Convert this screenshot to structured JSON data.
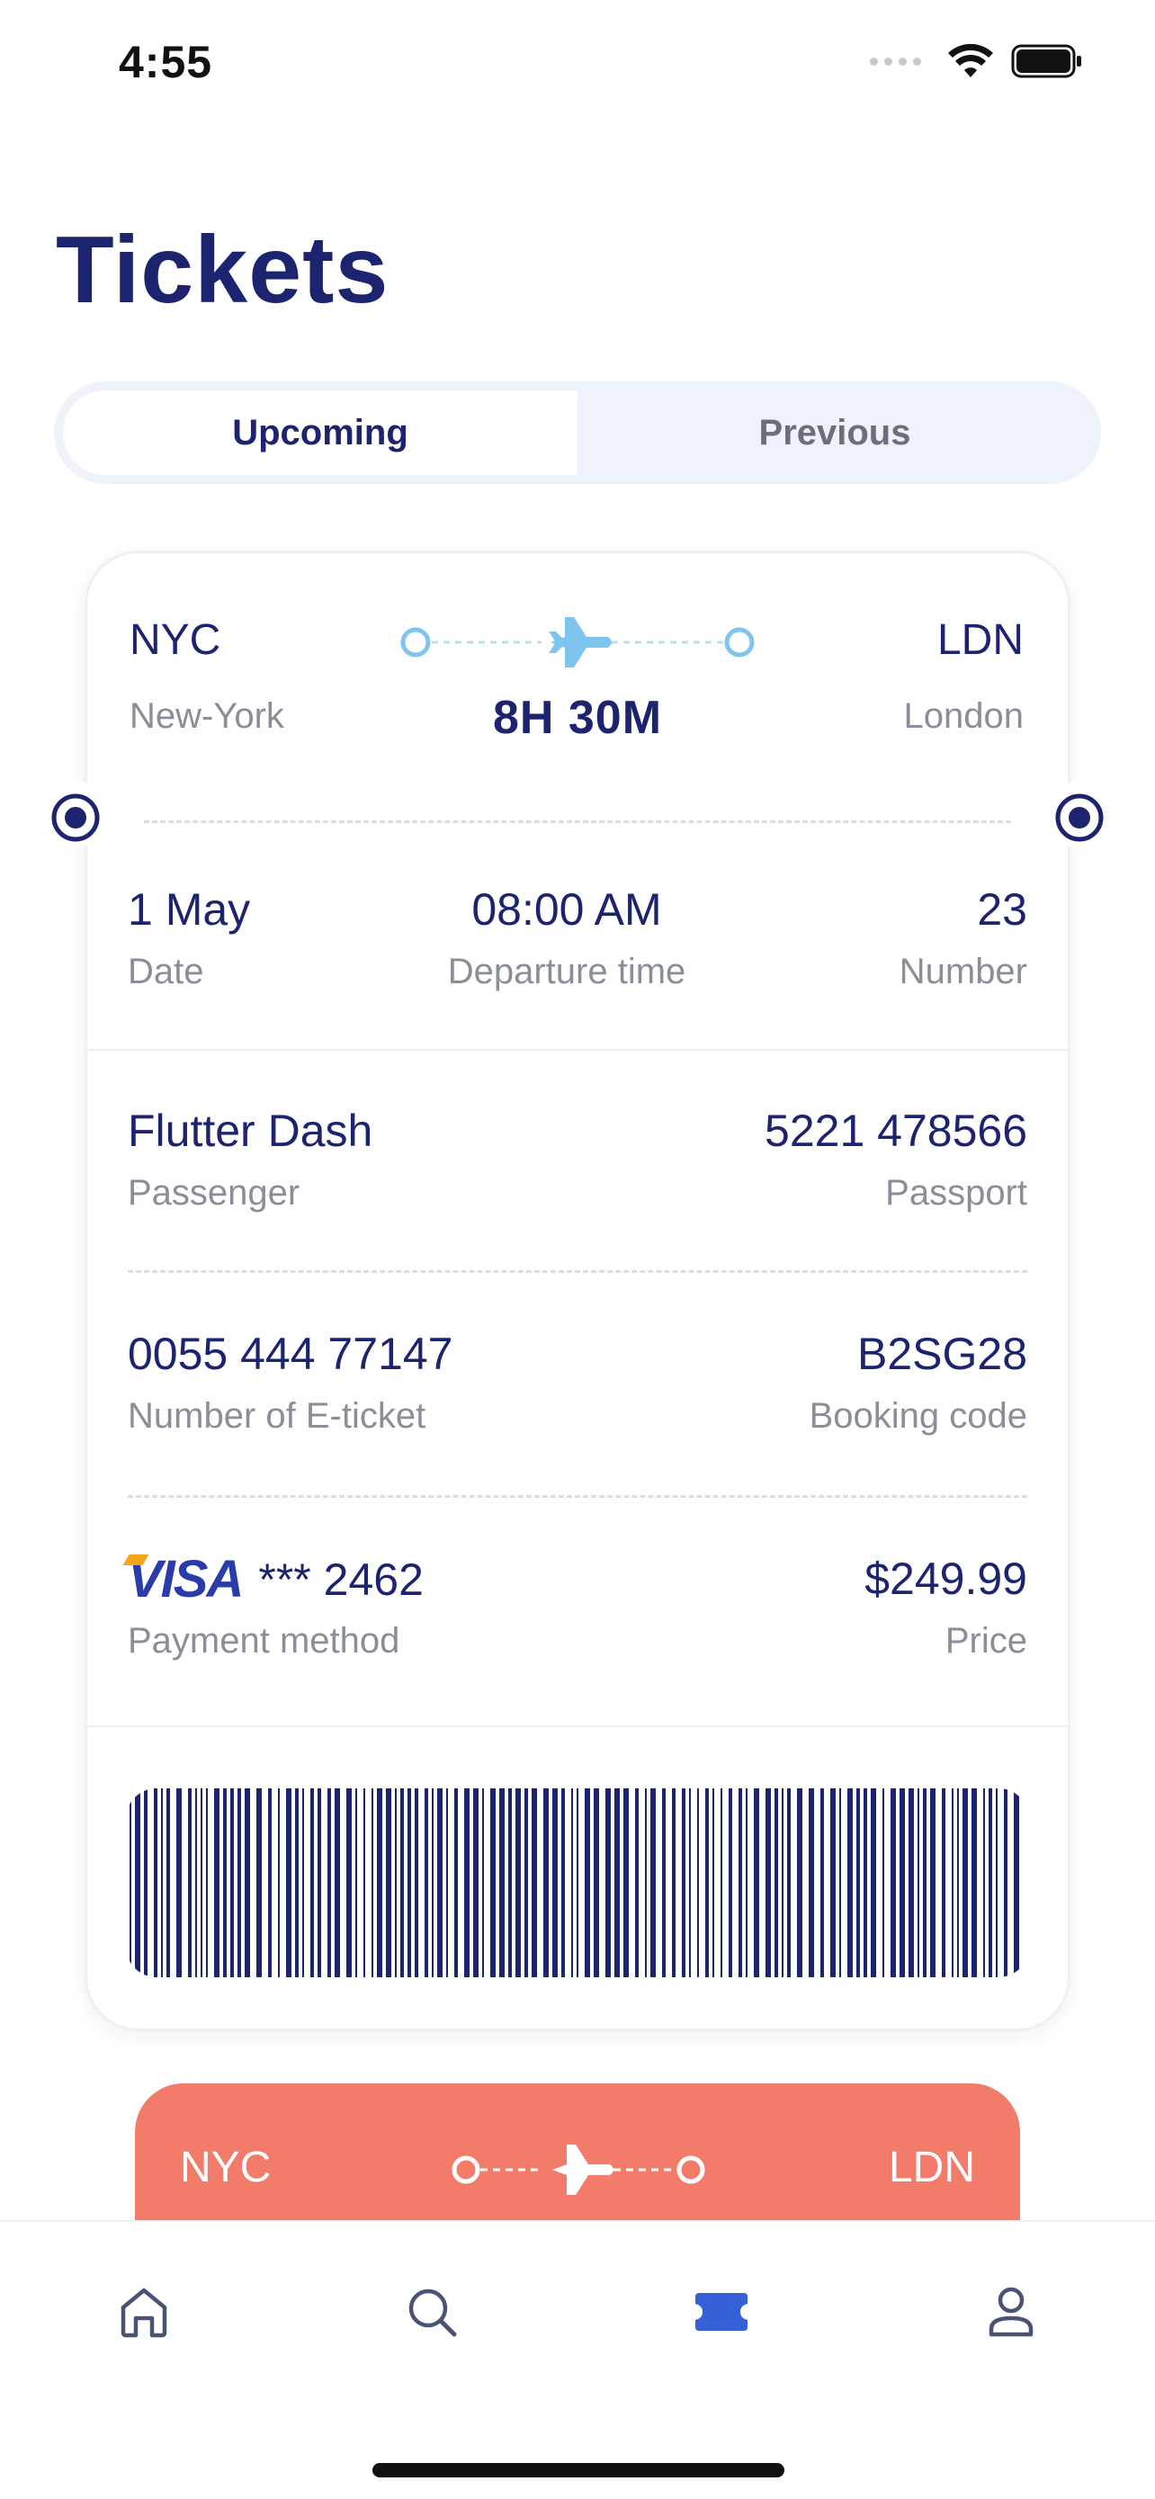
{
  "status_bar": {
    "time": "4:55"
  },
  "title": "Tickets",
  "tabs": [
    {
      "label": "Upcoming",
      "active": true
    },
    {
      "label": "Previous",
      "active": false
    }
  ],
  "ticket": {
    "from": {
      "code": "NYC",
      "city": "New-York"
    },
    "to": {
      "code": "LDN",
      "city": "London"
    },
    "duration": "8H 30M",
    "date": {
      "value": "1 May",
      "label": "Date"
    },
    "departure": {
      "value": "08:00 AM",
      "label": "Departure time"
    },
    "number": {
      "value": "23",
      "label": "Number"
    },
    "passenger": {
      "value": "Flutter Dash",
      "label": "Passenger"
    },
    "passport": {
      "value": "5221 478566",
      "label": "Passport"
    },
    "eticket": {
      "value": "0055 444 77147",
      "label": "Number of E-ticket"
    },
    "booking": {
      "value": "B2SG28",
      "label": "Booking code"
    },
    "payment": {
      "brand": "VISA",
      "value": "*** 2462",
      "label": "Payment method"
    },
    "price": {
      "value": "$249.99",
      "label": "Price"
    }
  },
  "next_ticket": {
    "from": "NYC",
    "to": "LDN",
    "color": "#f27b6a"
  },
  "colors": {
    "primary": "#1c2470",
    "accent": "#7fc4ef",
    "muted": "#8a8e99",
    "active_tab_icon": "#3560d8"
  },
  "tabbar": [
    {
      "name": "home",
      "icon": "home-icon",
      "active": false
    },
    {
      "name": "search",
      "icon": "search-icon",
      "active": false
    },
    {
      "name": "tickets",
      "icon": "ticket-icon",
      "active": true
    },
    {
      "name": "profile",
      "icon": "profile-icon",
      "active": false
    }
  ]
}
